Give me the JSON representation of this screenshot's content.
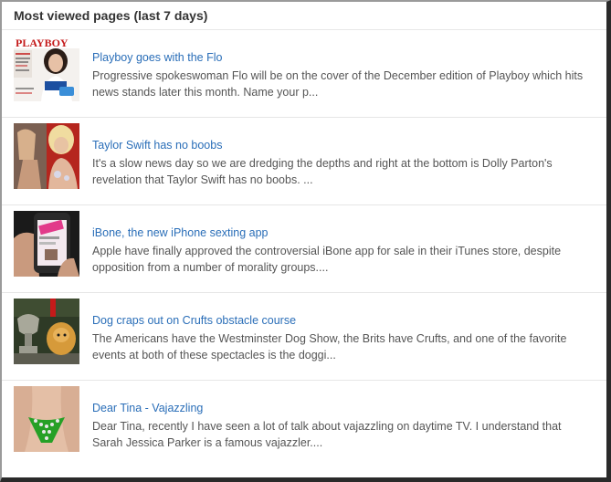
{
  "widget": {
    "title": "Most viewed pages (last 7 days)"
  },
  "articles": [
    {
      "title": "Playboy goes with the Flo",
      "snippet": "Progressive spokeswoman Flo will be on the cover of the December edition of Playboy which hits news stands later this month. Name your p...",
      "thumb": "magazine-cover",
      "thumb_text": "PLAYBOY"
    },
    {
      "title": "Taylor Swift has no boobs",
      "snippet": "It's a slow news day so we are dredging the depths and right at the bottom is Dolly Parton's revelation that Taylor Swift has no boobs. ...",
      "thumb": "two-women-photo"
    },
    {
      "title": "iBone, the new iPhone sexting app",
      "snippet": "Apple have finally approved the controversial iBone app for sale in their iTunes store, despite opposition from a number of morality groups....",
      "thumb": "phone-in-hand"
    },
    {
      "title": "Dog craps out on Crufts obstacle course",
      "snippet": "The Americans have the Westminster Dog Show, the Brits have Crufts, and one of the favorite events at both of these spectacles is the doggi...",
      "thumb": "trophy-and-dog"
    },
    {
      "title": "Dear Tina - Vajazzling",
      "snippet": "Dear Tina, recently I have seen a lot of talk about vajazzling on daytime TV. I understand that Sarah Jessica Parker is a famous vajazzler....",
      "thumb": "green-jewel-bikini"
    }
  ],
  "colors": {
    "link": "#2a6eb8",
    "text": "#555555",
    "header": "#333333"
  }
}
